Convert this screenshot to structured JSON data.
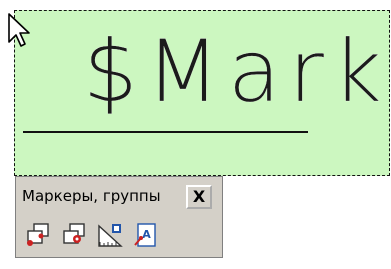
{
  "canvas": {
    "text_object": {
      "text": "$Mark"
    }
  },
  "toolbar": {
    "title": "Маркеры, группы",
    "close_label": "X",
    "buttons": [
      {
        "icon": "marker-create-icon"
      },
      {
        "icon": "marker-edit-icon"
      },
      {
        "icon": "marker-dimension-icon"
      },
      {
        "icon": "marker-text-icon"
      }
    ]
  },
  "colors": {
    "selection_fill": "#ccf7c0",
    "toolbar_bg": "#d4d0c8",
    "icon_red": "#cc2222",
    "icon_blue": "#2255aa"
  }
}
